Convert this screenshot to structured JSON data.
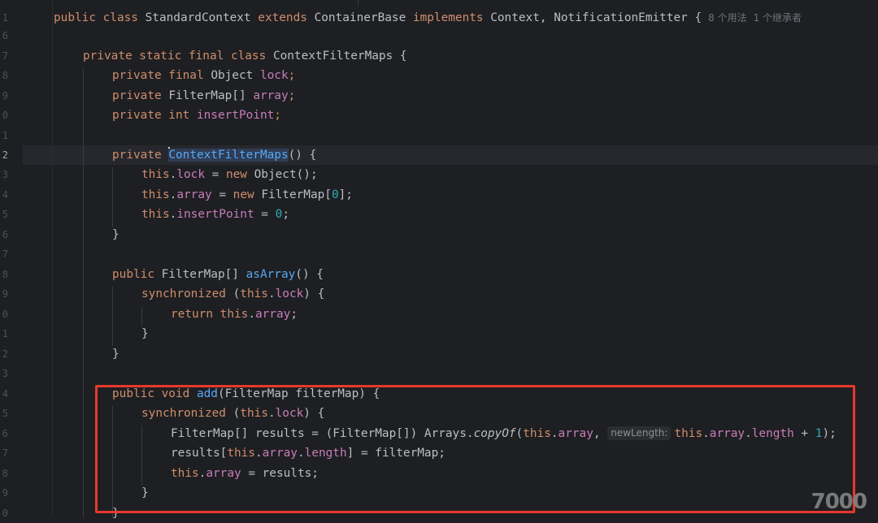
{
  "gutter": {
    "line_numbers": [
      "1",
      "6",
      "7",
      "8",
      "9",
      "0",
      "1",
      "2",
      "3",
      "4",
      "5",
      "6",
      "7",
      "8",
      "9",
      "0",
      "1",
      "2",
      "3",
      "4",
      "5",
      "6",
      "7",
      "8",
      "9",
      "0"
    ],
    "active_index": 7
  },
  "usage_hints": {
    "usages": "8 个用法",
    "inheritors": "1 个继承者"
  },
  "param_hint": "newLength:",
  "watermark": "7000",
  "colors": {
    "background": "#1e1f22",
    "keyword": "#cf8e6d",
    "field": "#c77dbb",
    "method": "#56a8f5",
    "number": "#2aacb8",
    "highlight_box": "#e8382c"
  },
  "code": {
    "l0": {
      "a": "public class",
      "b": "StandardContext",
      "c": "extends",
      "d": "ContainerBase",
      "e": "implements",
      "f": "Context, NotificationEmitter {"
    },
    "l2": {
      "a": "private static final class",
      "b": "ContextFilterMaps {"
    },
    "l3": {
      "a": "private final",
      "b": "Object",
      "c": "lock",
      ";": ";"
    },
    "l4": {
      "a": "private",
      "b": "FilterMap[]",
      "c": "array",
      ";": ";"
    },
    "l5": {
      "a": "private int",
      "c": "insertPoint",
      ";": ";"
    },
    "l7": {
      "a": "private",
      "b": "ContextFilterMaps",
      "c": "() {"
    },
    "l8": {
      "a": "this",
      ".": ".",
      "b": "lock",
      "c": " = ",
      "d": "new",
      "e": " Object();"
    },
    "l9": {
      "a": "this",
      ".": ".",
      "b": "array",
      "c": " = ",
      "d": "new",
      "e": " FilterMap[",
      "n": "0",
      "f": "];"
    },
    "l10": {
      "a": "this",
      ".": ".",
      "b": "insertPoint",
      "c": " = ",
      "n": "0",
      "f": ";"
    },
    "l11": {
      "a": "}"
    },
    "l13": {
      "a": "public",
      "b": " FilterMap[] ",
      "c": "asArray",
      "d": "() {"
    },
    "l14": {
      "a": "synchronized",
      "b": " (",
      "c": "this",
      ".": ".",
      "d": "lock",
      "e": ") {"
    },
    "l15": {
      "a": "return",
      "b": "this",
      ".": ".",
      "c": "array",
      "d": ";"
    },
    "l16": {
      "a": "}"
    },
    "l17": {
      "a": "}"
    },
    "l19": {
      "a": "public void",
      "b": "add",
      "c": "(FilterMap filterMap) {"
    },
    "l20": {
      "a": "synchronized",
      "b": " (",
      "c": "this",
      ".": ".",
      "d": "lock",
      "e": ") {"
    },
    "l21": {
      "a": "FilterMap[] results = (FilterMap[]) Arrays.",
      "b": "copyOf",
      "c": "(",
      "d": "this",
      ".": ".",
      "e": "array",
      ",": ", ",
      "f": "this",
      ".2": ".",
      "g": "array",
      ".3": ".",
      "h": "length",
      "i": " + ",
      "n": "1",
      "j": ");"
    },
    "l22": {
      "a": "results[",
      "b": "this",
      ".": ".",
      "c": "array",
      ".2": ".",
      "d": "length",
      "e": "] = filterMap;"
    },
    "l23": {
      "a": "this",
      ".": ".",
      "b": "array",
      "c": " = results;"
    },
    "l24": {
      "a": "}"
    },
    "l25": {
      "a": "}"
    }
  }
}
